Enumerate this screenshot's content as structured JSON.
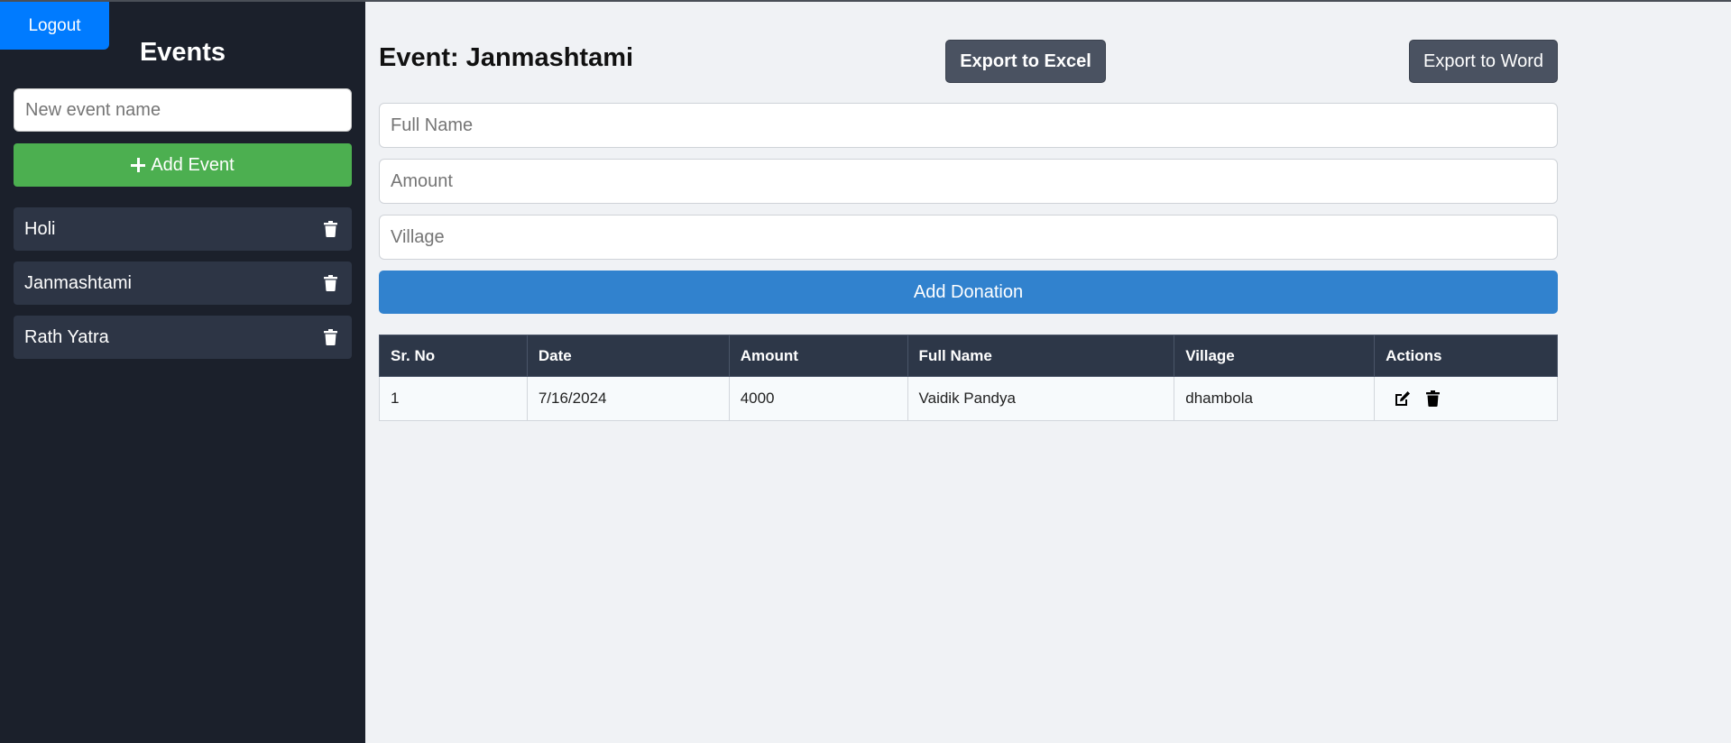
{
  "sidebar": {
    "logout_label": "Logout",
    "title": "Events",
    "new_event_placeholder": "New event name",
    "add_event_label": "Add Event",
    "events": [
      {
        "name": "Holi"
      },
      {
        "name": "Janmashtami"
      },
      {
        "name": "Rath Yatra"
      }
    ]
  },
  "main": {
    "event_title": "Event: Janmashtami",
    "export_excel_label": "Export to Excel",
    "export_word_label": "Export to Word",
    "full_name_placeholder": "Full Name",
    "amount_placeholder": "Amount",
    "village_placeholder": "Village",
    "add_donation_label": "Add Donation",
    "table": {
      "headers": [
        "Sr. No",
        "Date",
        "Amount",
        "Full Name",
        "Village",
        "Actions"
      ],
      "rows": [
        {
          "sr_no": "1",
          "date": "7/16/2024",
          "amount": "4000",
          "full_name": "Vaidik Pandya",
          "village": "dhambola"
        }
      ]
    }
  },
  "colors": {
    "sidebar_bg": "#1b202b",
    "event_item_bg": "#2d3545",
    "logout_blue": "#007bff",
    "add_event_green": "#4caf50",
    "add_donation_blue": "#3182ce",
    "export_button_gray": "#4a5261",
    "table_header_bg": "#2d3748"
  },
  "icons": {
    "event_delete": "trash-icon",
    "row_edit": "edit-icon",
    "row_delete": "trash-icon",
    "add": "plus-icon"
  }
}
